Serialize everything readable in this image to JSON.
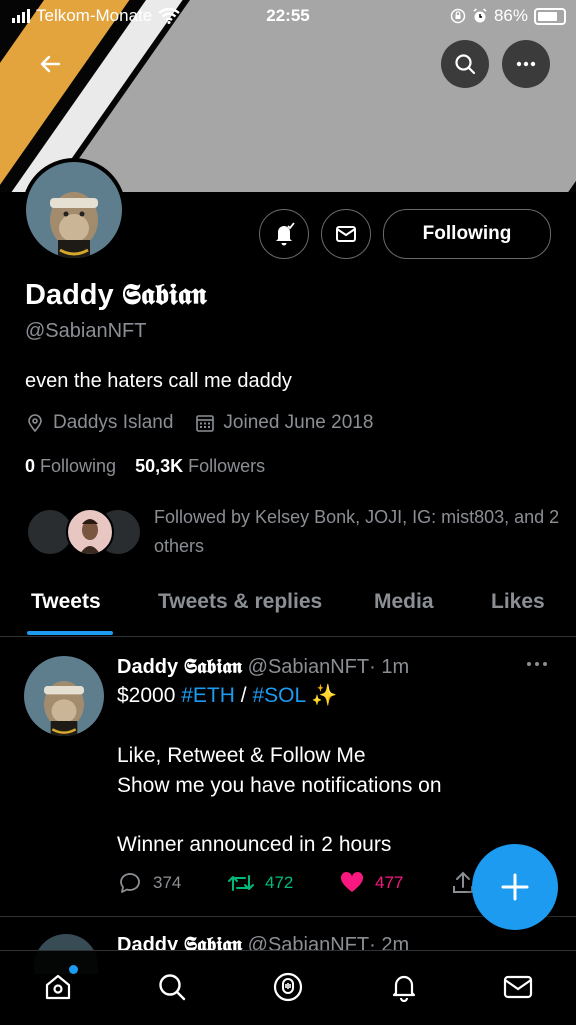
{
  "status_bar": {
    "carrier": "Telkom-Monate",
    "time": "22:55",
    "battery_percent": "86%"
  },
  "profile": {
    "name_plain": "Daddy",
    "name_fancy": "𝕾𝖆𝖇𝖎𝖆𝖓",
    "handle": "@SabianNFT",
    "bio": "even the haters call me daddy",
    "location": "Daddys Island",
    "joined": "Joined June 2018",
    "following_count": "0",
    "following_label": "Following",
    "followers_count": "50,3K",
    "followers_label": "Followers",
    "followed_by": "Followed by Kelsey Bonk, JOJI, IG: mist803, and 2 others",
    "follow_button_label": "Following"
  },
  "tabs": [
    {
      "label": "Tweets",
      "active": true
    },
    {
      "label": "Tweets & replies",
      "active": false
    },
    {
      "label": "Media",
      "active": false
    },
    {
      "label": "Likes",
      "active": false
    }
  ],
  "tweet": {
    "name_plain": "Daddy",
    "name_fancy": "𝕾𝖆𝖇𝖎𝖆𝖓",
    "handle": "@SabianNFT",
    "time": "· 1m",
    "line1_amount": "$2000",
    "line1_tag1": "#ETH",
    "line1_sep": "/",
    "line1_tag2": "#SOL",
    "line1_emoji": "✨",
    "line2": "Like, Retweet & Follow Me",
    "line3": "Show me you have notifications on",
    "line4": "Winner announced in 2 hours",
    "replies": "374",
    "retweets": "472",
    "likes": "477"
  },
  "tweet2": {
    "name_plain": "Daddy",
    "name_fancy": "𝕾𝖆𝖇𝖎𝖆𝖓",
    "handle": "@SabianNFT",
    "time": "· 2m"
  },
  "colors": {
    "accent": "#1d9bf0",
    "retweet_green": "#00ba7c",
    "like_pink": "#f91880",
    "secondary_text": "#8b8f94"
  }
}
